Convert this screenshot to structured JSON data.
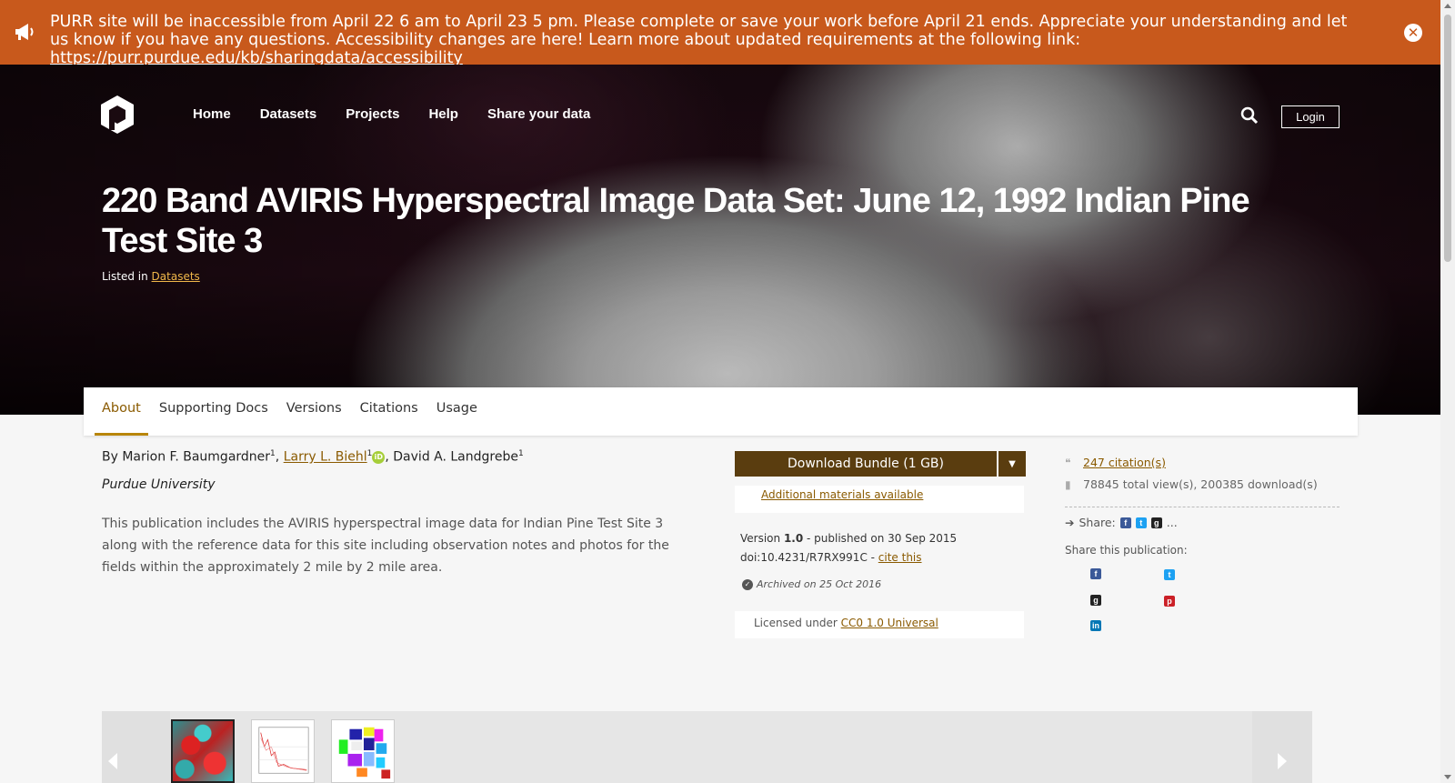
{
  "banner": {
    "message": "PURR site will be inaccessible from April 22 6 am to April 23 5 pm. Please complete or save your work before April 21 ends. Appreciate your understanding and let us know if you have any questions. Accessibility changes are here! Learn more about updated requirements at the following link: ",
    "link": "https://purr.purdue.edu/kb/sharingdata/accessibility",
    "icon": "megaphone-icon",
    "close_icon": "close-icon"
  },
  "nav": {
    "items": [
      "Home",
      "Datasets",
      "Projects",
      "Help",
      "Share your data"
    ],
    "login_label": "Login",
    "search_icon": "search-icon"
  },
  "hero": {
    "title": "220 Band AVIRIS Hyperspectral Image Data Set: June 12, 1992 Indian Pine Test Site 3",
    "listed_prefix": "Listed in ",
    "listed_link": "Datasets"
  },
  "tabs": [
    "About",
    "Supporting Docs",
    "Versions",
    "Citations",
    "Usage"
  ],
  "authors": {
    "prefix": "By ",
    "a1": "Marion F. Baumgardner",
    "a2": "Larry L. Biehl",
    "a3": "David A. Landgrebe",
    "sup": "1",
    "orcid": "iD"
  },
  "affiliation": "Purdue University",
  "abstract": "This publication includes the AVIRIS hyperspectral image data for Indian Pine Test Site 3 along with the reference data for this site including observation notes and photos for the fields within the approximately 2 mile by 2 mile area.",
  "download": {
    "label": "Download Bundle (1 GB)",
    "additional": "Additional materials available"
  },
  "version": {
    "prefix": "Version ",
    "number": "1.0",
    "published": " - published on 30 Sep 2015",
    "doi": "doi:10.4231/R7RX991C - ",
    "cite": "cite this",
    "archived": "Archived on 25 Oct 2016"
  },
  "license": {
    "prefix": "Licensed under ",
    "link": "CC0 1.0 Universal"
  },
  "metrics": {
    "citations": "247 citation(s)",
    "views": "78845 total view(s), 200385 download(s)",
    "share_prefix": "Share:",
    "share_more": "...",
    "share_label": "Share this publication:"
  },
  "colors": {
    "banner": "#c8591c",
    "accent": "#8a5a00",
    "download_button": "#5a3d0f"
  }
}
